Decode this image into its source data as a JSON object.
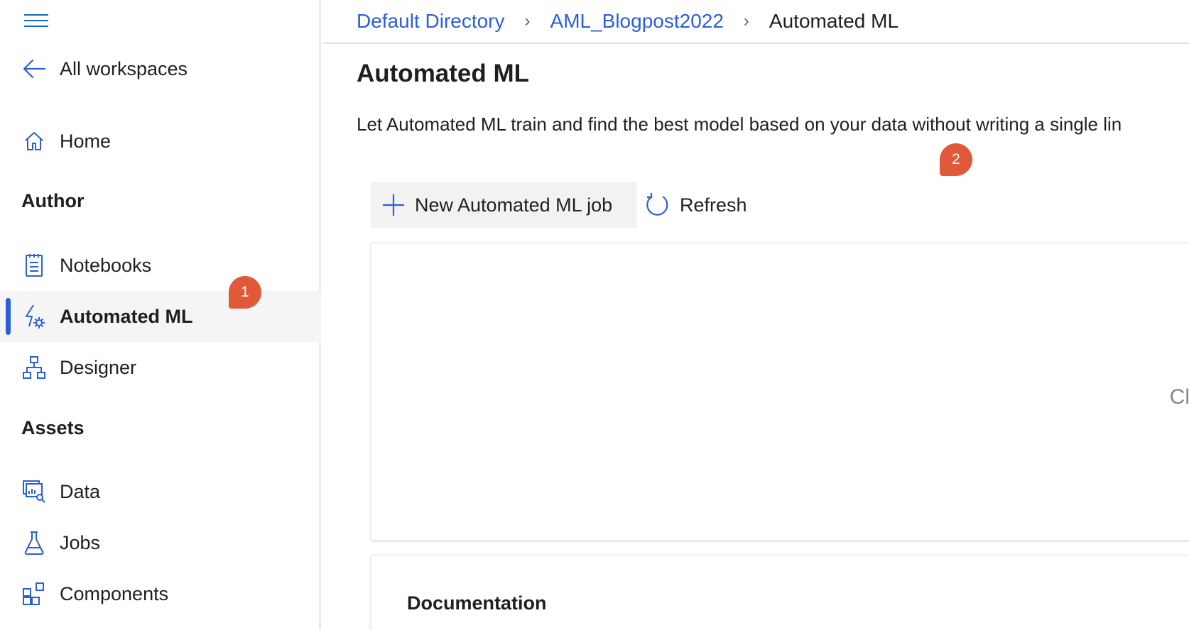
{
  "sidebar": {
    "back_label": "All workspaces",
    "home_label": "Home",
    "author_heading": "Author",
    "author_items": [
      {
        "label": "Notebooks",
        "icon": "notebook-icon"
      },
      {
        "label": "Automated ML",
        "icon": "automated-ml-icon",
        "active": true
      },
      {
        "label": "Designer",
        "icon": "designer-icon"
      }
    ],
    "assets_heading": "Assets",
    "assets_items": [
      {
        "label": "Data",
        "icon": "data-icon"
      },
      {
        "label": "Jobs",
        "icon": "jobs-flask-icon"
      },
      {
        "label": "Components",
        "icon": "components-icon"
      }
    ]
  },
  "badges": {
    "step1": "1",
    "step2": "2"
  },
  "breadcrumb": {
    "items": [
      "Default Directory",
      "AML_Blogpost2022",
      "Automated ML"
    ]
  },
  "main": {
    "title": "Automated ML",
    "description": "Let Automated ML train and find the best model based on your data without writing a single lin",
    "toolbar": {
      "new_job_label": "New Automated ML job",
      "refresh_label": "Refresh"
    },
    "card_truncated_text": "Cl",
    "documentation_heading": "Documentation"
  },
  "colors": {
    "accent": "#2b5fd9",
    "badge": "#e05a3a",
    "active_bg": "#f5f5f5"
  }
}
